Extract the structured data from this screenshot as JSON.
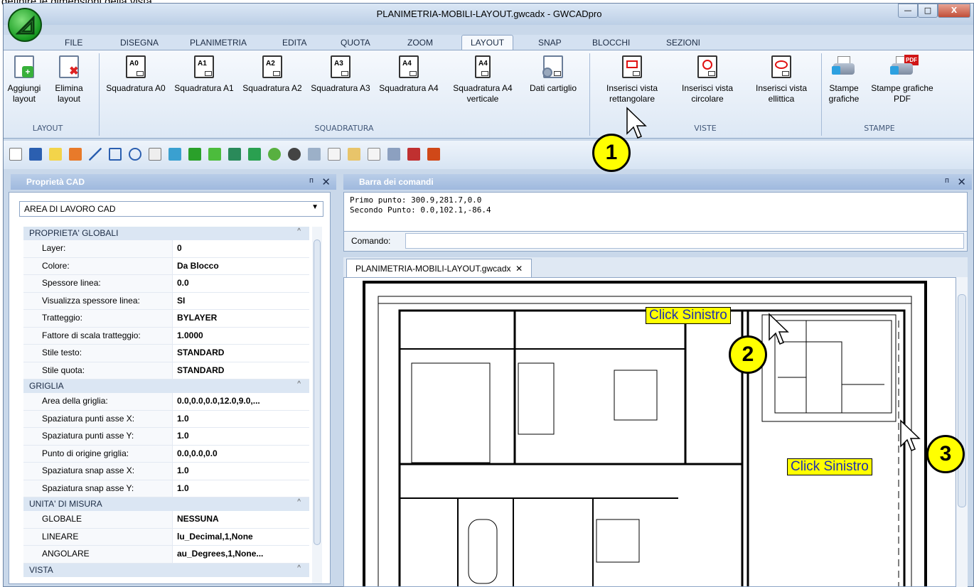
{
  "window": {
    "title": "PLANIMETRIA-MOBILI-LAYOUT.gwcadx - GWCADpro",
    "caption_text": "definire le dimensioni della vista."
  },
  "window_buttons": {
    "minimize": "—",
    "maximize": "□",
    "close": "X"
  },
  "tabs": [
    "FILE",
    "DISEGNA",
    "PLANIMETRIA",
    "EDITA",
    "QUOTA",
    "ZOOM",
    "LAYOUT",
    "SNAP",
    "BLOCCHI",
    "SEZIONI"
  ],
  "active_tab": "LAYOUT",
  "ribbon": {
    "add_layout": "Aggiungi layout",
    "del_layout": "Elimina layout",
    "a0": "Squadratura A0",
    "a1": "Squadratura A1",
    "a2": "Squadratura A2",
    "a3": "Squadratura A3",
    "a4": "Squadratura A4",
    "a4v": "Squadratura A4 verticale",
    "cartiglio": "Dati cartiglio",
    "vista_rett": "Inserisci vista rettangolare",
    "vista_circ": "Inserisci vista circolare",
    "vista_ell": "Inserisci vista ellittica",
    "stampe": "Stampe grafiche",
    "stampe_pdf": "Stampe grafiche PDF",
    "groups": {
      "layout": "LAYOUT",
      "squadratura": "SQUADRATURA",
      "viste": "VISTE",
      "stampe": "STAMPE"
    },
    "paper_tags": {
      "a0": "A0",
      "a1": "A1",
      "a2": "A2",
      "a3": "A3",
      "a4": "A4",
      "a4v": "A4",
      "pdf": "PDF"
    }
  },
  "props_panel": {
    "title": "Proprietà CAD",
    "selected": "AREA DI LAVORO CAD",
    "pin": "ᴨ",
    "close": "✕"
  },
  "props": [
    {
      "cat": "PROPRIETA' GLOBALI",
      "rows": [
        [
          "Layer:",
          "0"
        ],
        [
          "Colore:",
          "Da Blocco"
        ],
        [
          "Spessore linea:",
          "0.0"
        ],
        [
          "Visualizza spessore linea:",
          "SI"
        ],
        [
          "Tratteggio:",
          "BYLAYER"
        ],
        [
          "Fattore di scala tratteggio:",
          "1.0000"
        ],
        [
          "Stile testo:",
          "STANDARD"
        ],
        [
          "Stile quota:",
          "STANDARD"
        ]
      ]
    },
    {
      "cat": "GRIGLIA",
      "rows": [
        [
          "Area della griglia:",
          "0.0,0.0,0.0,12.0,9.0,..."
        ],
        [
          "Spaziatura punti asse X:",
          "1.0"
        ],
        [
          "Spaziatura punti asse Y:",
          "1.0"
        ],
        [
          "Punto di origine griglia:",
          "0.0,0.0,0.0"
        ],
        [
          "Spaziatura snap asse X:",
          "1.0"
        ],
        [
          "Spaziatura snap asse Y:",
          "1.0"
        ]
      ]
    },
    {
      "cat": "UNITA' DI MISURA",
      "rows": [
        [
          "GLOBALE",
          "NESSUNA"
        ],
        [
          "LINEARE",
          "lu_Decimal,1,None"
        ],
        [
          "ANGOLARE",
          "au_Degrees,1,None..."
        ]
      ]
    },
    {
      "cat": "VISTA",
      "rows": []
    }
  ],
  "cmd_panel": {
    "title": "Barra dei comandi",
    "line1": "Primo punto: 300.9,281.7,0.0",
    "line2": "Secondo Punto: 0.0,102.1,-86.4",
    "prompt": "Comando:",
    "pin": "ᴨ",
    "close": "✕"
  },
  "doc_tab": {
    "name": "PLANIMETRIA-MOBILI-LAYOUT.gwcadx",
    "close": "✕"
  },
  "annotations": {
    "b1": "1",
    "b2": "2",
    "b3": "3",
    "click1": "Click Sinistro",
    "click2": "Click Sinistro"
  }
}
